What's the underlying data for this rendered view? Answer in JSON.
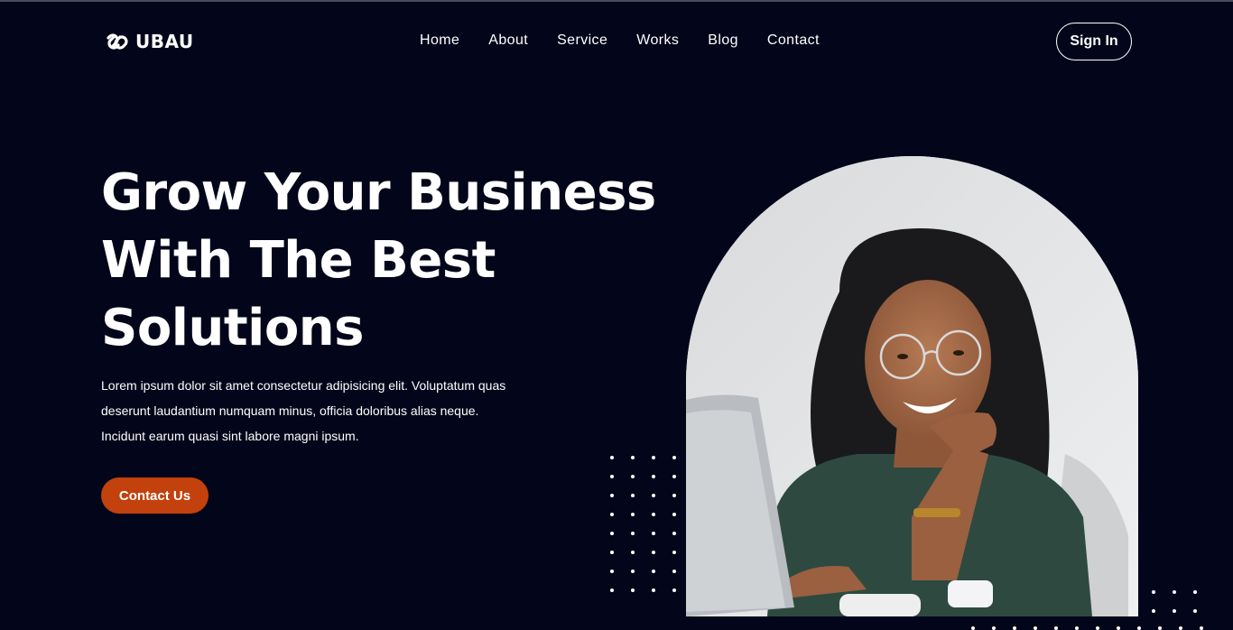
{
  "brand": {
    "name": "UBAU",
    "icon": "chain-link-icon"
  },
  "nav": {
    "items": [
      {
        "label": "Home"
      },
      {
        "label": "About"
      },
      {
        "label": "Service"
      },
      {
        "label": "Works"
      },
      {
        "label": "Blog"
      },
      {
        "label": "Contact"
      }
    ]
  },
  "header": {
    "signin_label": "Sign In"
  },
  "hero": {
    "title_lines": [
      "Grow Your Business",
      "With The Best",
      "Solutions"
    ],
    "description_lines": [
      "Lorem ipsum dolor sit amet consectetur adipisicing elit. Voluptatum quas",
      "deserunt laudantium numquam minus, officia doloribus alias neque.",
      "Incidunt earum quasi sint labore magni ipsum."
    ],
    "cta_label": "Contact Us",
    "image": "smiling-woman-with-glasses-at-laptop-photo"
  },
  "colors": {
    "background": "#03051a",
    "accent": "#c2410c",
    "text": "#ffffff"
  }
}
